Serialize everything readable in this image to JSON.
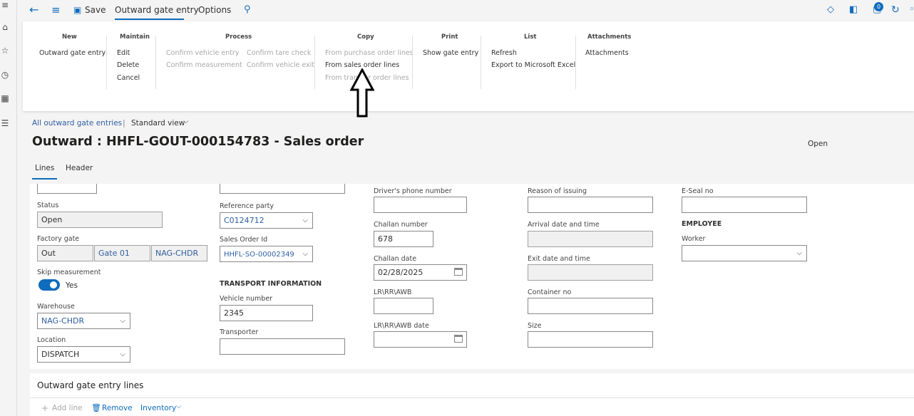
{
  "toolbar": {
    "save_label": "Save",
    "tab_active": "Outward gate entry",
    "tab_options": "Options",
    "badge_count": "0"
  },
  "ribbon": {
    "groups": {
      "new": {
        "title": "New",
        "items": [
          "Outward gate entry"
        ]
      },
      "maintain": {
        "title": "Maintain",
        "items": [
          "Edit",
          "Delete",
          "Cancel"
        ]
      },
      "process": {
        "title": "Process",
        "items": [
          "Confirm vehicle entry",
          "Confirm measurement",
          "Confirm tare check",
          "Confirm vehicle exit"
        ]
      },
      "copy": {
        "title": "Copy",
        "items": [
          "From purchase order lines",
          "From sales order lines",
          "From transfer order lines"
        ]
      },
      "print": {
        "title": "Print",
        "items": [
          "Show gate entry"
        ]
      },
      "list": {
        "title": "List",
        "items": [
          "Refresh",
          "Export to Microsoft Excel"
        ]
      },
      "attachments": {
        "title": "Attachments",
        "items": [
          "Attachments"
        ]
      }
    }
  },
  "page": {
    "breadcrumb": "All outward gate entries",
    "breadcrumb_sep": "|",
    "view": "Standard view",
    "title": "Outward : HHFL-GOUT-000154783 - Sales order",
    "status": "Open",
    "tabs": [
      "Lines",
      "Header"
    ]
  },
  "form": {
    "col1": {
      "status_label": "Status",
      "status_value": "Open",
      "factory_gate_label": "Factory gate",
      "factory_gate_dir": "Out",
      "factory_gate_gate": "Gate 01",
      "factory_gate_site": "NAG-CHDR",
      "skip_label": "Skip measurement",
      "skip_value": "Yes",
      "warehouse_label": "Warehouse",
      "warehouse_value": "NAG-CHDR",
      "location_label": "Location",
      "location_value": "DISPATCH"
    },
    "col2": {
      "refparty_label": "Reference party",
      "refparty_value": "C0124712",
      "soid_label": "Sales Order Id",
      "soid_value": "HHFL-SO-00002349",
      "transport_heading": "TRANSPORT INFORMATION",
      "vehicle_label": "Vehicle number",
      "vehicle_value": "2345",
      "transporter_label": "Transporter",
      "transporter_value": ""
    },
    "col3": {
      "driver_phone_label": "Driver's phone number",
      "driver_phone_value": "",
      "challan_label": "Challan number",
      "challan_value": "678",
      "challan_date_label": "Challan date",
      "challan_date_value": "02/28/2025",
      "lr_label": "LR\\RR\\AWB",
      "lr_value": "",
      "lr_date_label": "LR\\RR\\AWB date",
      "lr_date_value": ""
    },
    "col4": {
      "reason_label": "Reason of issuing",
      "reason_value": "",
      "arrival_label": "Arrival date and time",
      "arrival_value": "",
      "exit_label": "Exit date and time",
      "exit_value": "",
      "container_label": "Container no",
      "container_value": "",
      "size_label": "Size",
      "size_value": ""
    },
    "col5": {
      "eseal_label": "E-Seal no",
      "eseal_value": "",
      "employee_heading": "EMPLOYEE",
      "worker_label": "Worker",
      "worker_value": ""
    }
  },
  "lines_section": {
    "title": "Outward gate entry lines",
    "add_line": "Add line",
    "remove": "Remove",
    "inventory": "Inventory"
  },
  "colors": {
    "accent": "#0f6cbd",
    "link": "#2f5f9f",
    "disabled": "#a8a8a8"
  }
}
